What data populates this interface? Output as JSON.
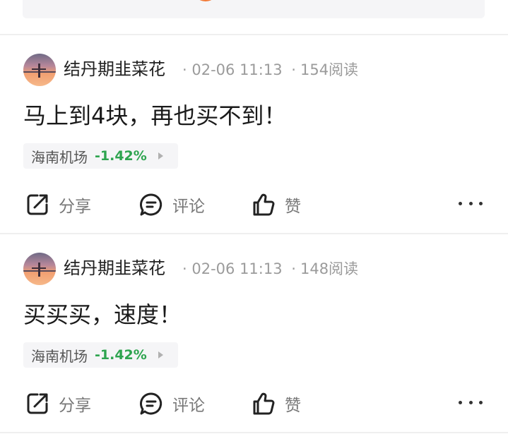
{
  "posts": [
    {
      "author": "结丹期韭菜花",
      "time": "02-06 11:13",
      "reads": "154阅读",
      "content": "马上到4块，再也买不到！",
      "stock": {
        "name": "海南机场",
        "change": "-1.42%"
      }
    },
    {
      "author": "结丹期韭菜花",
      "time": "02-06 11:13",
      "reads": "148阅读",
      "content": "买买买，速度！",
      "stock": {
        "name": "海南机场",
        "change": "-1.42%"
      }
    }
  ],
  "meta_separator": "·",
  "actions": {
    "share": "分享",
    "comment": "评论",
    "like": "赞"
  },
  "icons": {
    "share": "share-icon",
    "comment": "comment-icon",
    "like": "thumbs-up-icon",
    "more": "more-icon",
    "stock_arrow": "triangle-right-icon"
  },
  "colors": {
    "stock_change": "#2ea44f",
    "muted_text": "#9b9b9b",
    "tag_background": "#f5f5f7",
    "divider": "#efefef"
  }
}
